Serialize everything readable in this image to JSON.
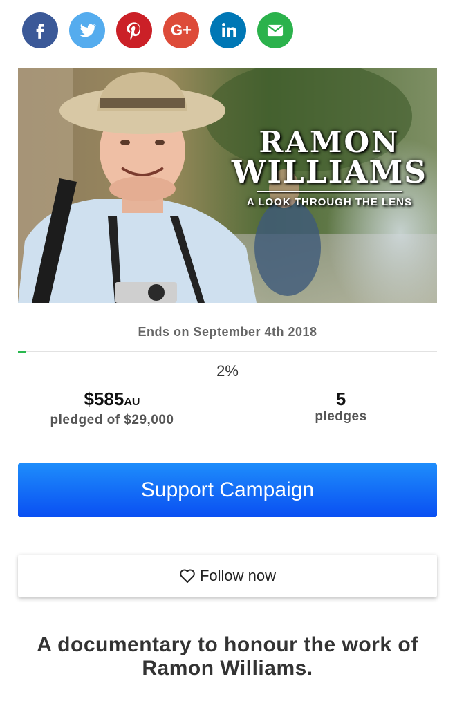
{
  "share": {
    "buttons": [
      {
        "name": "facebook",
        "color": "#3b5998"
      },
      {
        "name": "twitter",
        "color": "#55acee"
      },
      {
        "name": "pinterest",
        "color": "#cb2027"
      },
      {
        "name": "google-plus",
        "color": "#dd4b39"
      },
      {
        "name": "linkedin",
        "color": "#0077b5"
      },
      {
        "name": "email",
        "color": "#2bb24c"
      }
    ],
    "gplus_label": "G+"
  },
  "hero": {
    "title_line1": "RAMON",
    "title_line2": "WILLIAMS",
    "subtitle": "A LOOK THROUGH THE LENS"
  },
  "campaign": {
    "ends_text": "Ends on September 4th 2018",
    "progress_fraction": 0.02,
    "percent_text": "2%",
    "amount": "$585",
    "currency": "AU",
    "pledged_text": "pledged of $29,000",
    "pledges_count": "5",
    "pledges_label": "pledges"
  },
  "actions": {
    "support_label": "Support Campaign",
    "follow_label": "Follow now"
  },
  "tagline": "A documentary to honour the work of Ramon Williams.",
  "colors": {
    "progress": "#2ab84f",
    "support_top": "#1e8dfb",
    "support_bottom": "#0a4ff2"
  }
}
